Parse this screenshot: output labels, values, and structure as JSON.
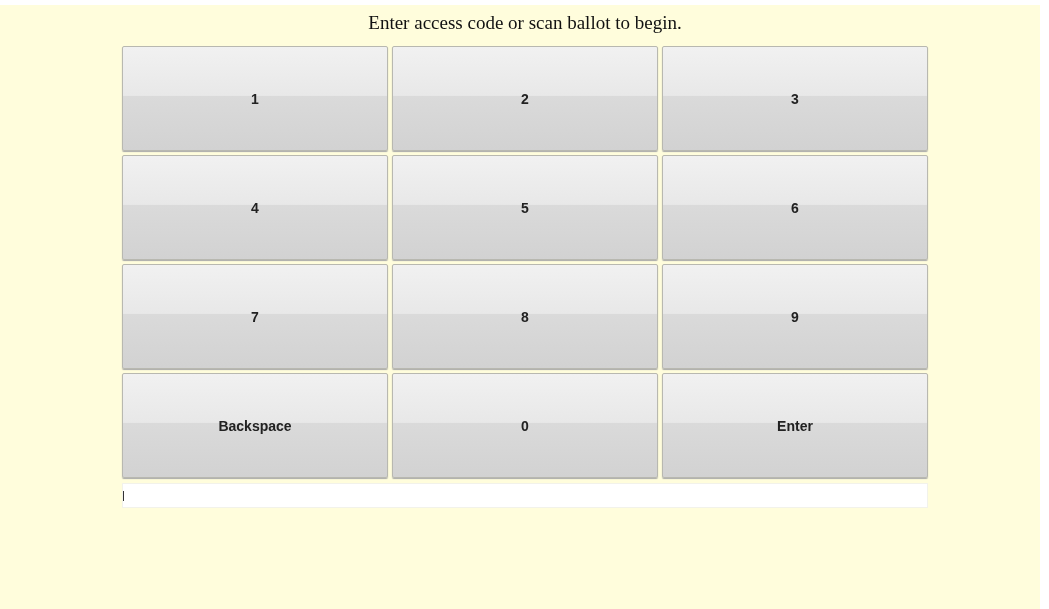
{
  "prompt": "Enter access code or scan ballot to begin.",
  "keys": [
    {
      "label": "1"
    },
    {
      "label": "2"
    },
    {
      "label": "3"
    },
    {
      "label": "4"
    },
    {
      "label": "5"
    },
    {
      "label": "6"
    },
    {
      "label": "7"
    },
    {
      "label": "8"
    },
    {
      "label": "9"
    },
    {
      "label": "Backspace"
    },
    {
      "label": "0"
    },
    {
      "label": "Enter"
    }
  ],
  "code_field": {
    "focused": true
  }
}
